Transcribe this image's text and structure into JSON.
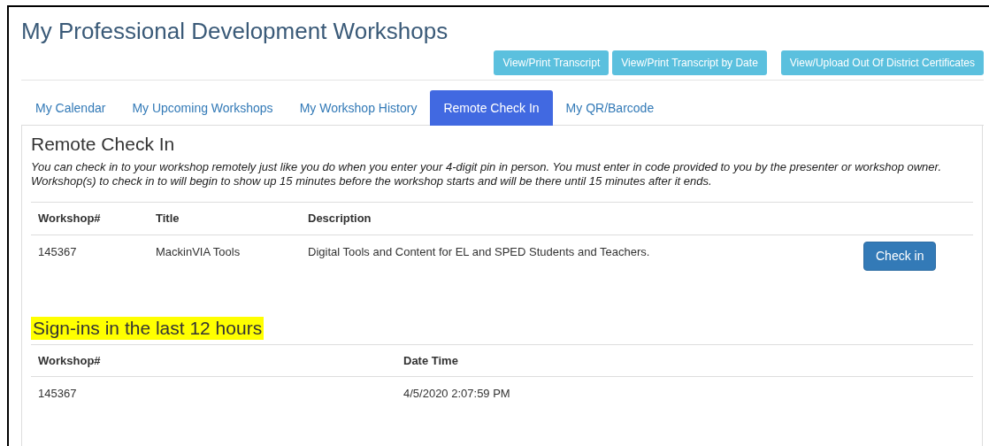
{
  "page_title": "My Professional Development Workshops",
  "action_buttons": [
    {
      "label": "View/Print Transcript"
    },
    {
      "label": "View/Print Transcript by Date"
    },
    {
      "label": "View/Upload Out Of District Certificates"
    }
  ],
  "tabs": [
    {
      "label": "My Calendar",
      "selected": false
    },
    {
      "label": "My Upcoming Workshops",
      "selected": false
    },
    {
      "label": "My Workshop History",
      "selected": false
    },
    {
      "label": "Remote Check In",
      "selected": true
    },
    {
      "label": "My QR/Barcode",
      "selected": false
    }
  ],
  "panel": {
    "heading": "Remote Check In",
    "instructions": "You can check in to your workshop remotely just like you do when you enter your 4-digit pin in person. You must enter in code provided to you by the presenter or workshop owner. Workshop(s) to check in to will begin to show up 15 minutes before the workshop starts and will be there until 15 minutes after it ends.",
    "workshops_table": {
      "columns": [
        "Workshop#",
        "Title",
        "Description"
      ],
      "rows": [
        {
          "cells": [
            "145367",
            "MackinVIA Tools",
            "Digital Tools and Content for EL and SPED Students and Teachers."
          ],
          "action": "Check in"
        }
      ]
    },
    "signins_heading": {
      "text": "Sign-ins in the last 12 hours",
      "highlighted": true
    },
    "signins_table": {
      "columns": [
        "Workshop#",
        "Date Time"
      ],
      "rows": [
        {
          "cells": [
            "145367",
            "4/5/2020 2:07:59 PM"
          ]
        }
      ]
    }
  }
}
